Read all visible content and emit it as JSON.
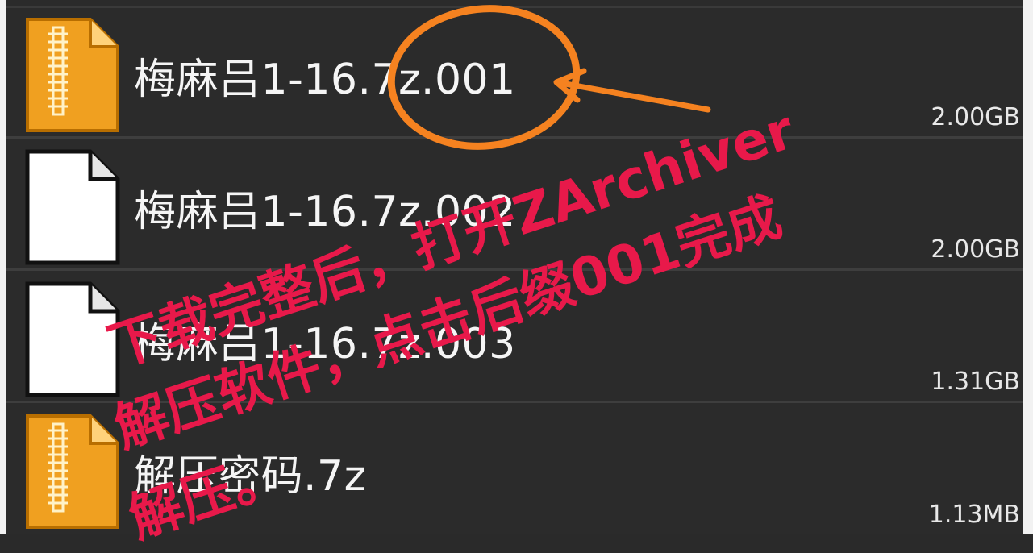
{
  "files": [
    {
      "name": "梅麻吕1-16.7z.001",
      "size": "2.00GB",
      "icon": "zip-archive-icon"
    },
    {
      "name": "梅麻吕1-16.7z.002",
      "size": "2.00GB",
      "icon": "blank-file-icon"
    },
    {
      "name": "梅麻吕1-16.7z.003",
      "size": "1.31GB",
      "icon": "blank-file-icon"
    },
    {
      "name": "解压密码.7z",
      "size": "1.13MB",
      "icon": "zip-archive-icon"
    }
  ],
  "annotation": {
    "line1": "下载完整后，打开ZArchiver",
    "line2": "解压软件，点击后缀001完成",
    "line3": "解压。",
    "text_color": "#e8194a",
    "circle_color": "#f58220"
  },
  "colors": {
    "background": "#2b2b2b",
    "archive_icon": "#f0a020",
    "file_icon": "#ffffff"
  }
}
